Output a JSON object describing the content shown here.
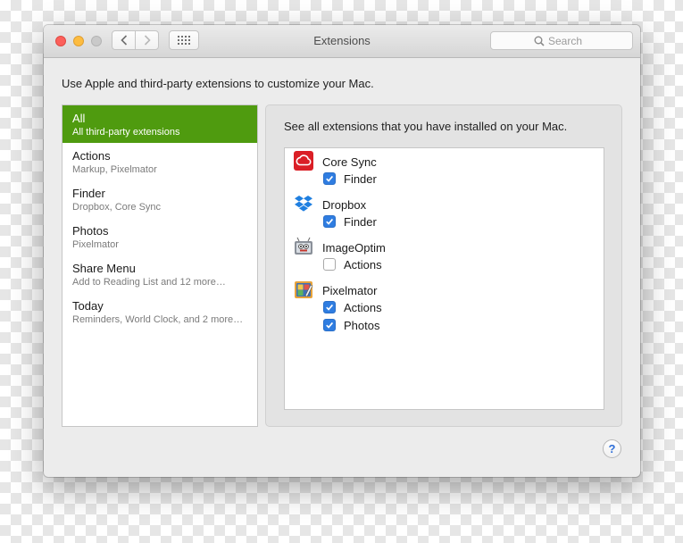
{
  "window": {
    "title": "Extensions",
    "search": {
      "placeholder": "Search",
      "value": ""
    },
    "traffic_lights": {
      "close": "#fc605b",
      "minimize": "#fdbc40",
      "zoom": "#c9c9c9"
    }
  },
  "toolbar": {
    "back_icon": "chevron-left-icon",
    "forward_icon": "chevron-right-icon",
    "show_all_icon": "grid-icon"
  },
  "intro_text": "Use Apple and third-party extensions to customize your Mac.",
  "sidebar": {
    "selected_color": "#4f9b0f",
    "items": [
      {
        "title": "All",
        "subtitle": "All third-party extensions",
        "selected": true
      },
      {
        "title": "Actions",
        "subtitle": "Markup, Pixelmator",
        "selected": false
      },
      {
        "title": "Finder",
        "subtitle": "Dropbox, Core Sync",
        "selected": false
      },
      {
        "title": "Photos",
        "subtitle": "Pixelmator",
        "selected": false
      },
      {
        "title": "Share Menu",
        "subtitle": "Add to Reading List and 12 more…",
        "selected": false
      },
      {
        "title": "Today",
        "subtitle": "Reminders, World Clock, and 2 more…",
        "selected": false
      }
    ]
  },
  "panel": {
    "description": "See all extensions that you have installed on your Mac.",
    "checkbox_color": "#2f7de1",
    "extensions": [
      {
        "name": "Core Sync",
        "icon": "adobe-creative-cloud-icon",
        "options": [
          {
            "label": "Finder",
            "checked": true
          }
        ]
      },
      {
        "name": "Dropbox",
        "icon": "dropbox-icon",
        "options": [
          {
            "label": "Finder",
            "checked": true
          }
        ]
      },
      {
        "name": "ImageOptim",
        "icon": "imageoptim-icon",
        "options": [
          {
            "label": "Actions",
            "checked": false
          }
        ]
      },
      {
        "name": "Pixelmator",
        "icon": "pixelmator-icon",
        "options": [
          {
            "label": "Actions",
            "checked": true
          },
          {
            "label": "Photos",
            "checked": true
          }
        ]
      }
    ]
  },
  "help_button": {
    "label": "?"
  }
}
